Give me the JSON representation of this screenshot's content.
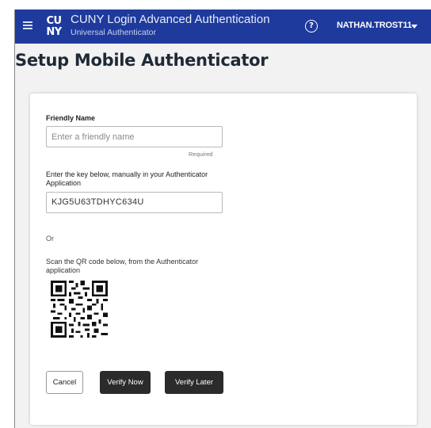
{
  "header": {
    "logo_text": "CUNY",
    "app_title": "CUNY Login Advanced Authentication",
    "app_subtitle": "Universal Authenticator",
    "help_icon": "help-circle-icon",
    "help_glyph": "?",
    "username": "NATHAN.TROST11",
    "user_menu_icon": "caret-down-icon",
    "background_color": "#1e3a9c"
  },
  "page": {
    "title": "Setup Mobile Authenticator"
  },
  "form": {
    "friendly_name_label": "Friendly Name",
    "friendly_name_placeholder": "Enter a friendly name",
    "friendly_name_value": "",
    "required_text": "Required",
    "key_instruction": "Enter the key below, manually in your Authenticator Application",
    "key_value": "KJG5U63TDHYC634U",
    "or_text": "Or",
    "scan_instruction": "Scan the QR code below, from the Authenticator application",
    "qr_icon": "qr-code-icon"
  },
  "buttons": {
    "cancel": "Cancel",
    "verify_now": "Verify Now",
    "verify_later": "Verify Later",
    "primary_color": "#2b2b2b"
  }
}
